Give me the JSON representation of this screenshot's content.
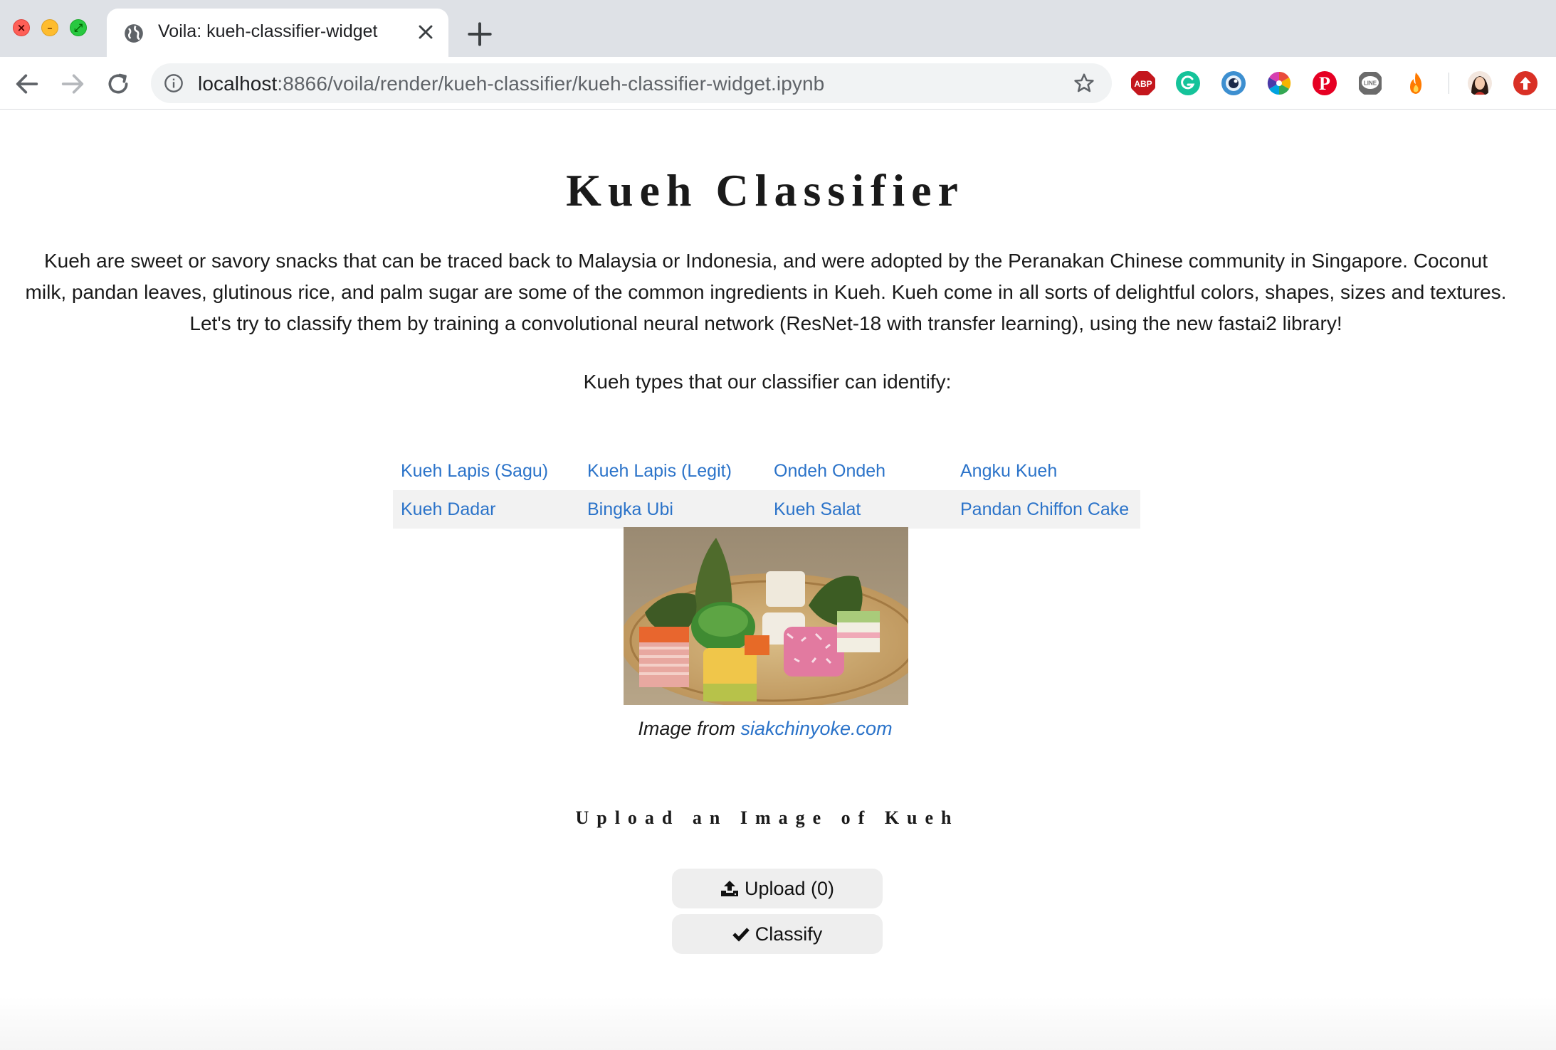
{
  "browser": {
    "tab_title": "Voila: kueh-classifier-widget",
    "url_host": "localhost",
    "url_path": ":8866/voila/render/kueh-classifier/kueh-classifier-widget.ipynb",
    "extensions": [
      {
        "name": "adblock-plus",
        "label": "ABP",
        "color": "#c4171d"
      },
      {
        "name": "grammarly",
        "label": "G",
        "color": "#15c39a"
      },
      {
        "name": "eye-extension",
        "label": "",
        "color": "#3d8fd0"
      },
      {
        "name": "color-wheel",
        "label": "",
        "color": "#e94b3c"
      },
      {
        "name": "pinterest",
        "label": "P",
        "color": "#e60023"
      },
      {
        "name": "line",
        "label": "LINE",
        "color": "#6b6b6b"
      },
      {
        "name": "fire-extension",
        "label": "",
        "color": "#ff7a00"
      },
      {
        "name": "update",
        "label": "",
        "color": "#d93025"
      }
    ]
  },
  "page": {
    "title": "Kueh Classifier",
    "intro": "Kueh are sweet or savory snacks that can be traced back to Malaysia or Indonesia, and were adopted by the Peranakan Chinese community in Singapore. Coconut milk, pandan leaves, glutinous rice, and palm sugar are some of the common ingredients in Kueh. Kueh come in all sorts of delightful colors, shapes, sizes and textures. Let's try to classify them by training a convolutional neural network (ResNet-18 with transfer learning), using the new fastai2 library!",
    "types_heading": "Kueh types that our classifier can identify:",
    "kueh_types": [
      [
        "Kueh Lapis (Sagu)",
        "Kueh Lapis (Legit)",
        "Ondeh Ondeh",
        "Angku Kueh"
      ],
      [
        "Kueh Dadar",
        "Bingka Ubi",
        "Kueh Salat",
        "Pandan Chiffon Cake"
      ]
    ],
    "caption_prefix": "Image from ",
    "caption_link": "siakchinyoke.com",
    "upload_heading": "Upload an Image of Kueh",
    "upload_button": "Upload (0)",
    "classify_button": "Classify"
  },
  "colors": {
    "link": "#2b73c9",
    "button_bg": "#eeeeee",
    "row_shade": "#f2f2f2",
    "tabbar_bg": "#dee1e6"
  }
}
